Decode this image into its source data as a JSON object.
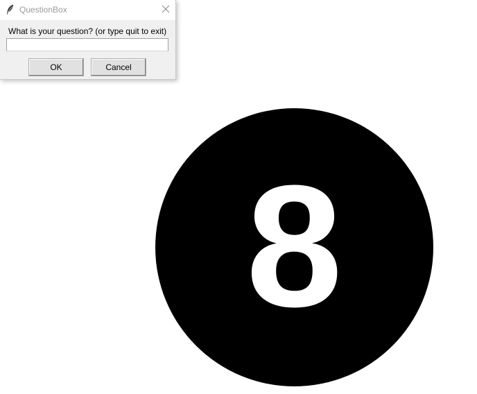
{
  "dialog": {
    "title": "QuestionBox",
    "prompt": "What is your question? (or type quit to exit)",
    "input_value": "",
    "ok_label": "OK",
    "cancel_label": "Cancel",
    "title_icon": "feather-icon",
    "close_icon": "close-icon"
  },
  "canvas": {
    "ball_number": "8",
    "ball_color": "#000000",
    "number_color": "#ffffff"
  }
}
